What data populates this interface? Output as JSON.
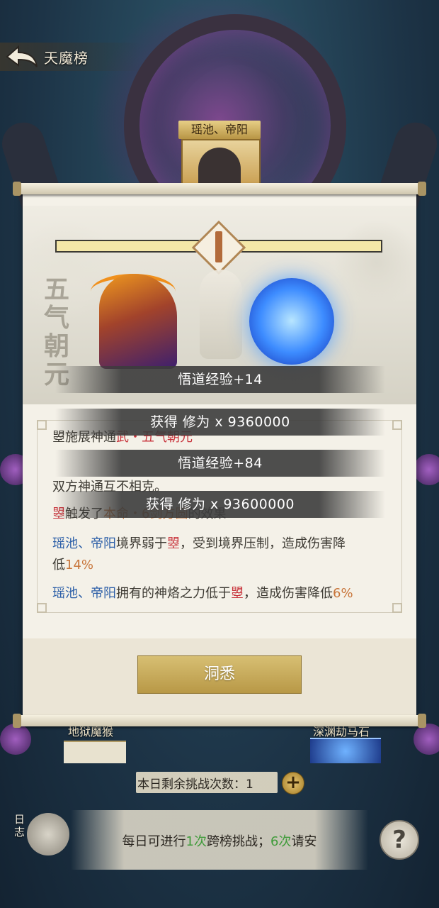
{
  "header": {
    "title": "天魔榜"
  },
  "opponent": {
    "name": "瑶池、帝阳"
  },
  "battle": {
    "calligraphy": "五气朝元",
    "exp_gain_1": "悟道经验+14",
    "reward_1": "获得 修为 x 9360000",
    "exp_gain_2": "悟道经验+84",
    "reward_2": "获得 修为 x 93600000"
  },
  "log": {
    "line1": {
      "a": "曌施展神通",
      "b": "武・五气朝元"
    },
    "line2": "双方神通互不相克。",
    "line3": {
      "a": "曌",
      "b": "触发了",
      "c": "本命・6剑方圆",
      "d": "的效果"
    },
    "line4": {
      "a": "瑶池、帝阳",
      "b": "境界弱于",
      "c": "曌",
      "d": "，受到境界压制，造成伤害降"
    },
    "line5": {
      "a": "低",
      "b": "14%"
    },
    "line6": {
      "a": "瑶池、帝阳",
      "b": "拥有的神烙之力低于",
      "c": "曌",
      "d": "，造成伤害降低",
      "e": "6%"
    }
  },
  "buttons": {
    "confirm": "洞悉",
    "plus": "+",
    "help": "?"
  },
  "bottom": {
    "left_name": "地狱魔猴",
    "right_name": "深渊劫马石",
    "remaining_label": "本日剩余挑战次数：",
    "remaining_count": "1",
    "info": {
      "a": "每日可进行",
      "b": "1次",
      "c": "跨榜挑战；",
      "d": "6次",
      "e": "请安"
    },
    "diary": "日志"
  },
  "colors": {
    "accent_gold": "#c9ad5d",
    "highlight_red": "#c8333b",
    "highlight_blue": "#2b5ea7",
    "highlight_orange": "#c8753a",
    "highlight_green": "#3f9b3a"
  }
}
